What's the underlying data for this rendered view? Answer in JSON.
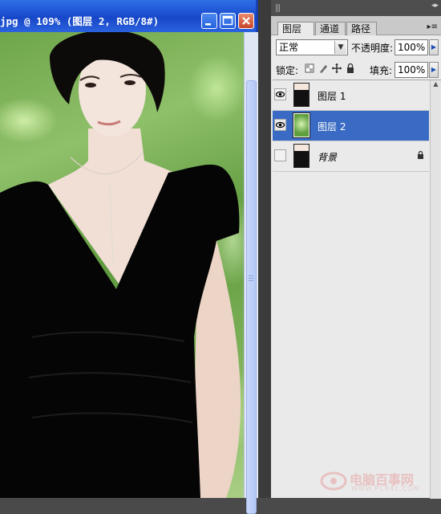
{
  "document": {
    "title": "jpg @ 109% (图层 2, RGB/8#)"
  },
  "panel": {
    "tabs": [
      "图层",
      "通道",
      "路径"
    ],
    "tab_close_glyph": "×",
    "blend_mode": "正常",
    "opacity_label": "不透明度:",
    "opacity_value": "100%",
    "lock_label": "锁定:",
    "fill_label": "填充:",
    "fill_value": "100%",
    "layers": [
      {
        "name": "图层 1",
        "visible": true,
        "selected": false,
        "thumbnail": "person-black-dress",
        "locked": false
      },
      {
        "name": "图层 2",
        "visible": true,
        "selected": true,
        "thumbnail": "green-bokeh-background",
        "locked": false
      },
      {
        "name": "背景",
        "visible": false,
        "selected": false,
        "thumbnail": "person-black-dress",
        "locked": true
      }
    ]
  },
  "watermark": {
    "text": "电脑百事网",
    "url": "WWW.PC841.COM"
  },
  "colors": {
    "titlebar": "#1b4fd0",
    "selection": "#3a6bc4",
    "panel_bg": "#eaeaea"
  }
}
